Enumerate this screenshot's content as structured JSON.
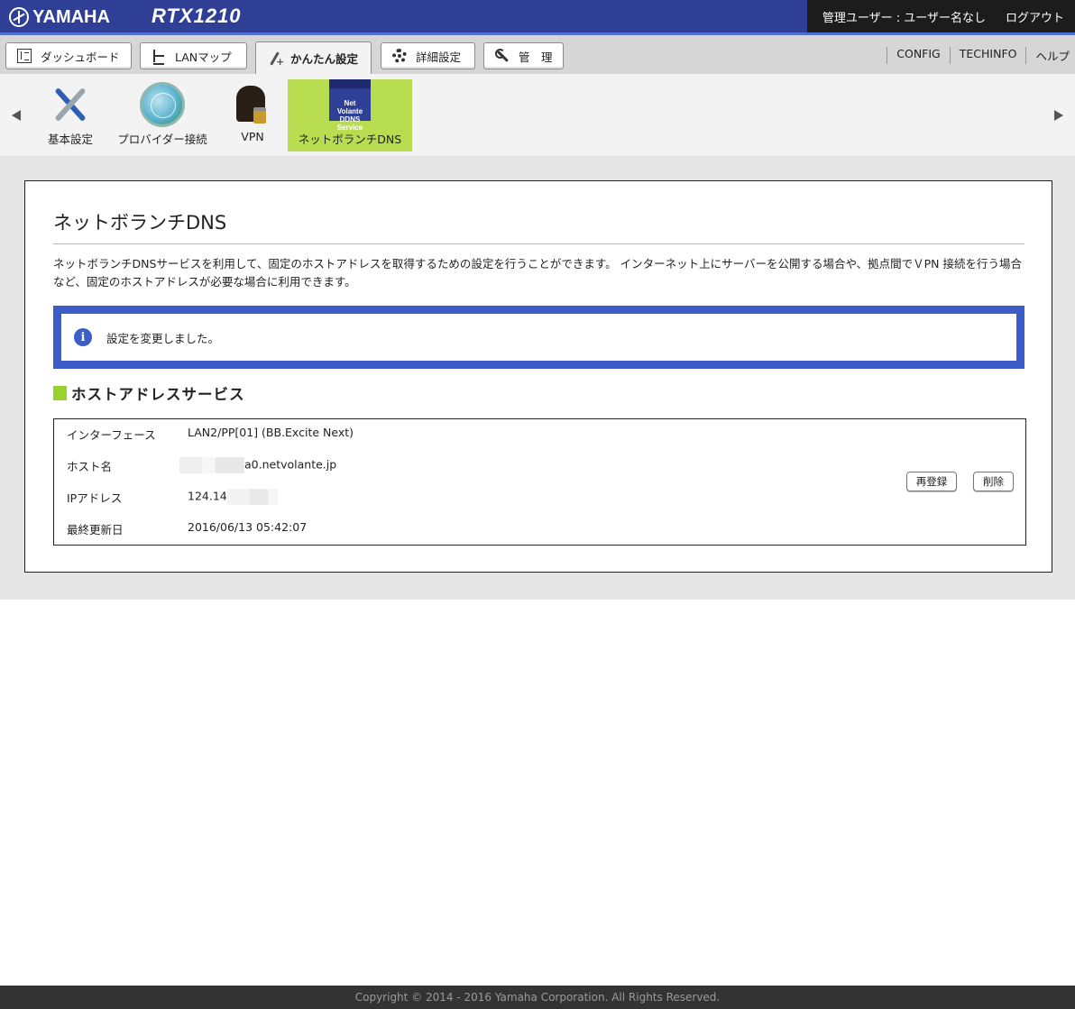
{
  "header": {
    "brand": "YAMAHA",
    "model": "RTX1210",
    "user_label": "管理ユーザー : ユーザー名なし",
    "logout": "ログアウト"
  },
  "nav": {
    "tabs": [
      {
        "label": "ダッシュボード",
        "icon": "dashboard-icon"
      },
      {
        "label": "LANマップ",
        "icon": "lan-map-icon"
      },
      {
        "label": "かんたん設定",
        "icon": "wand-icon",
        "active": true
      },
      {
        "label": "詳細設定",
        "icon": "gear-icon"
      },
      {
        "label": "管　理",
        "icon": "wrench-icon"
      }
    ],
    "links": [
      "CONFIG",
      "TECHINFO",
      "ヘルプ"
    ]
  },
  "iconstrip": {
    "items": [
      {
        "label": "基本設定",
        "icon": "tools-icon"
      },
      {
        "label": "プロバイダー接続",
        "icon": "globe-icon"
      },
      {
        "label": "VPN",
        "icon": "vpn-lock-icon"
      },
      {
        "label": "ネットボランチDNS",
        "icon": "ddns-service-icon",
        "selected": true
      }
    ],
    "ddns_badge": [
      "Net",
      "Volante",
      "DDNS",
      "Service"
    ],
    "active_color": "#b8dd50"
  },
  "main": {
    "title": "ネットボランチDNS",
    "description": "ネットボランチDNSサービスを利用して、固定のホストアドレスを取得するための設定を行うことができます。 インターネット上にサーバーを公開する場合や、拠点間でＶPN 接続を行う場合など、固定のホストアドレスが必要な場合に利用できます。",
    "notice": "設定を変更しました。",
    "section_title": "ホストアドレスサービス",
    "host": {
      "interface_label": "インターフェース",
      "interface_value": "LAN2/PP[01] (BB.Excite Next)",
      "hostname_label": "ホスト名",
      "hostname_value": "a0.netvolante.jp",
      "ip_label": "IPアドレス",
      "ip_value": "124.14",
      "updated_label": "最終更新日",
      "updated_value": "2016/06/13 05:42:07"
    },
    "buttons": {
      "reregister": "再登録",
      "delete": "削除"
    }
  },
  "footer": {
    "copyright": "Copyright © 2014 - 2016 Yamaha Corporation. All Rights Reserved."
  },
  "colors": {
    "header": "#2e3f95",
    "notice_border": "#3c5dc7",
    "section_bar": "#9ad12f"
  }
}
